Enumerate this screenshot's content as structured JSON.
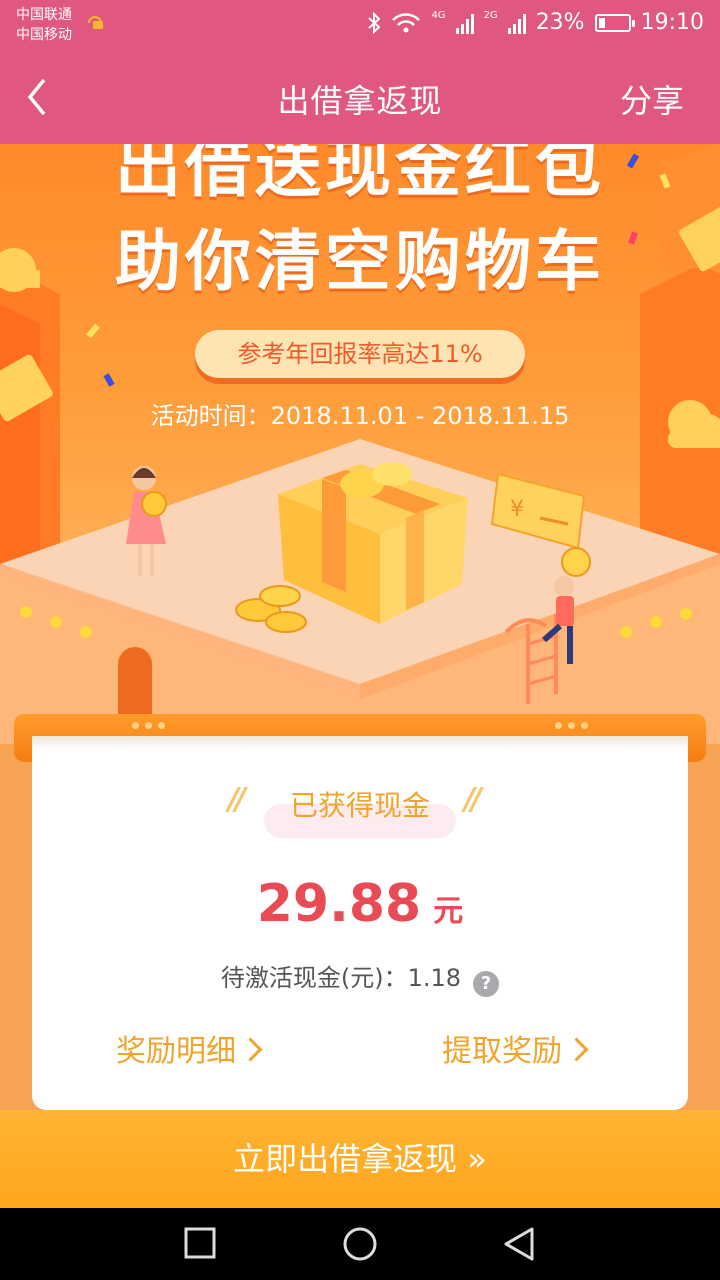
{
  "status_bar": {
    "carrier_1": "中国联通",
    "carrier_2": "中国移动",
    "net_1": "4G",
    "net_2": "2G",
    "battery": "23%",
    "battery_level": 0.23,
    "time": "19:10"
  },
  "nav": {
    "title": "出借拿返现",
    "share": "分享"
  },
  "hero": {
    "headline_1": "出借送现金红包",
    "headline_2": "助你清空购物车",
    "badge": "参考年回报率高达11%",
    "period": "活动时间：2018.11.01 - 2018.11.15",
    "coin_symbol": "¥"
  },
  "card": {
    "label": "已获得现金",
    "amount": "29.88",
    "unit": "元",
    "pending": "待激活现金(元)：1.18",
    "help": "?",
    "link_details": "奖励明细",
    "link_withdraw": "提取奖励"
  },
  "cta": {
    "label": "立即出借拿返现 »"
  },
  "colors": {
    "header": "#e0577f",
    "accent": "#f0a42c",
    "amount": "#e84b54",
    "cta": "#ffa51e"
  },
  "icons": {
    "back": "chevron-left-icon",
    "bluetooth": "bluetooth-icon",
    "wifi": "wifi-icon",
    "square": "recent-apps-icon",
    "circle": "home-icon",
    "triangle": "back-triangle-icon"
  }
}
